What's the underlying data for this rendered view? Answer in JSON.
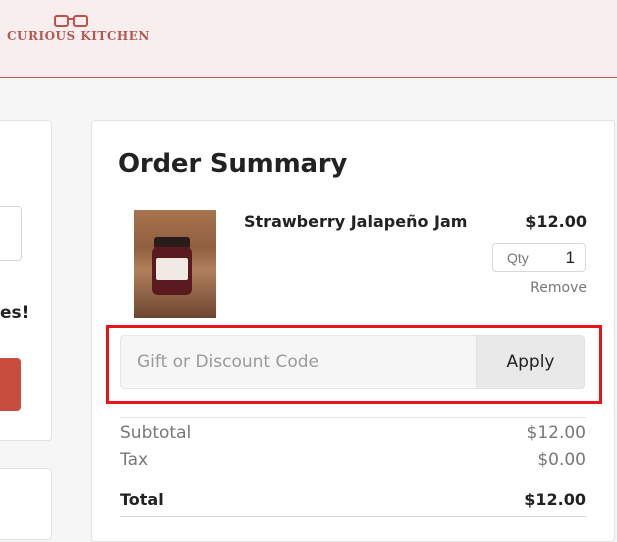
{
  "brand": {
    "name": "CURIOUS KITCHEN",
    "accent_color": "#c85a54",
    "logo_icon": "glasses-icon"
  },
  "left_panel": {
    "partial_text": "es!",
    "button_color": "#c84d3e"
  },
  "order_summary": {
    "title": "Order Summary",
    "item": {
      "name": "Strawberry Jalapeño Jam",
      "price": "$12.00",
      "qty_label": "Qty",
      "qty_value": "1",
      "remove_label": "Remove"
    },
    "discount": {
      "placeholder": "Gift or Discount Code",
      "apply_label": "Apply",
      "highlight_color": "#e8141a"
    },
    "totals": {
      "subtotal_label": "Subtotal",
      "subtotal_value": "$12.00",
      "tax_label": "Tax",
      "tax_value": "$0.00",
      "total_label": "Total",
      "total_value": "$12.00"
    }
  }
}
